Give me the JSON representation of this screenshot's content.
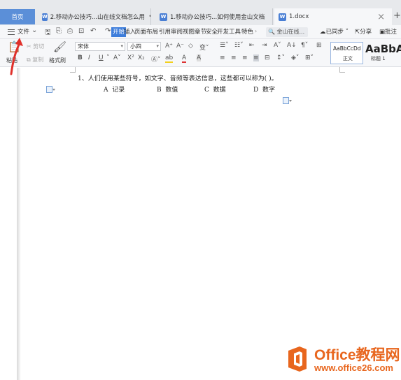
{
  "tabs": {
    "home": "首页",
    "doc1": "2.移动办公技巧...山在线文档怎么用",
    "doc2": "1.移动办公技巧...如何使用金山文档",
    "doc3": "1.docx",
    "close_glyph": "×",
    "add_glyph": "+",
    "doc_icon": "W"
  },
  "menu": {
    "file": "文件",
    "items": [
      "开始",
      "插入",
      "页面布局",
      "引用",
      "审阅",
      "视图",
      "章节",
      "安全",
      "开发工具",
      "特色"
    ],
    "search": "金山在线...",
    "sync": "已同步",
    "share": "分享",
    "comment": "批注"
  },
  "ribbon": {
    "paste": "粘贴",
    "cut": "剪切",
    "copy": "复制",
    "format_painter": "格式刷",
    "font_name": "宋体",
    "font_size": "小四",
    "bold": "B",
    "italic": "I",
    "underline": "U",
    "styles": [
      {
        "sample": "AaBbCcDd",
        "label": "正文"
      },
      {
        "sample": "AaBbA",
        "label": "标题 1"
      }
    ]
  },
  "document": {
    "question": "1、人们使用某些符号，如文字、音频等表达信息，这些都可以称为(        )。",
    "options": [
      {
        "letter": "A",
        "text": "记录"
      },
      {
        "letter": "B",
        "text": "数值"
      },
      {
        "letter": "C",
        "text": "数据"
      },
      {
        "letter": "D",
        "text": "数字"
      }
    ]
  },
  "watermark": {
    "title": "Office教程网",
    "url": "www.office26.com"
  },
  "colors": {
    "accent": "#3d7ddb",
    "arrow": "#e0302a",
    "watermark": "#e8661e"
  }
}
